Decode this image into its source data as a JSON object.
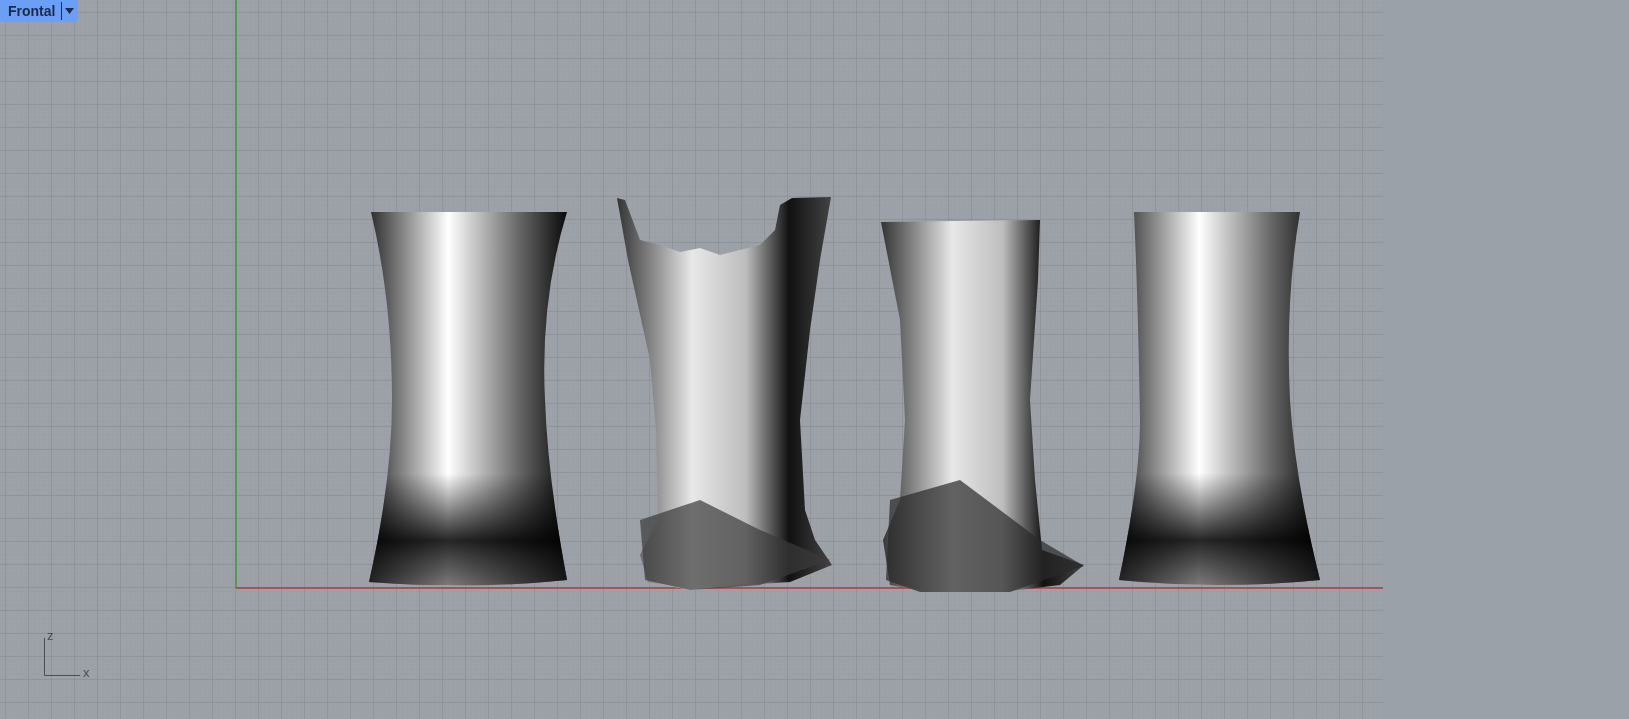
{
  "viewport": {
    "title": "Frontal",
    "axis_labels": [
      "z",
      "x"
    ]
  }
}
